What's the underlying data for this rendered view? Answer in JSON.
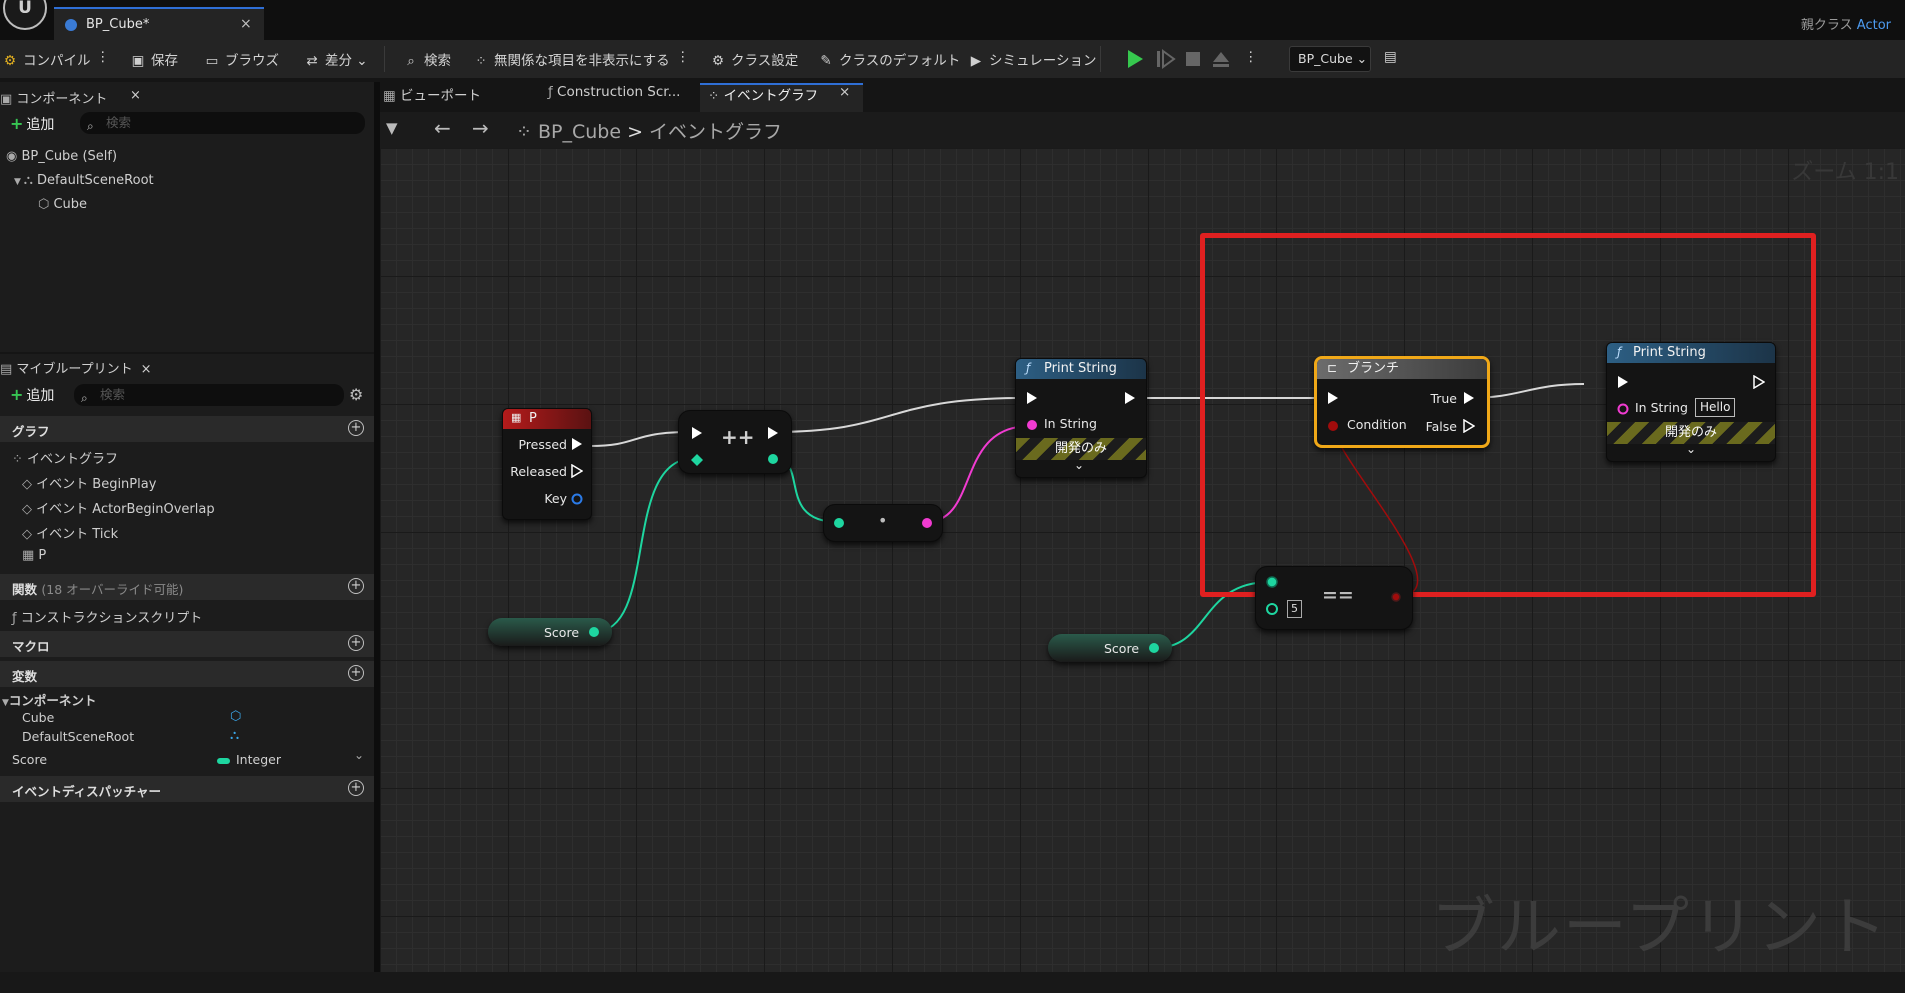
{
  "window": {
    "tab_title": "BP_Cube*",
    "tab_close": "×",
    "parent_class_label": "親クラス",
    "parent_class_value": "Actor"
  },
  "toolbar": {
    "compile": "コンパイル",
    "save": "保存",
    "browse": "ブラウズ",
    "diff": "差分",
    "search": "検索",
    "hide_unrelated": "無関係な項目を非表示にする",
    "class_settings": "クラス設定",
    "class_defaults": "クラスのデフォルト",
    "simulation": "シミュレーション",
    "debug_object": "BP_Cube"
  },
  "components_panel": {
    "tab": "コンポーネント",
    "close": "×",
    "add": "追加",
    "search_placeholder": "検索",
    "items": [
      "BP_Cube (Self)",
      "DefaultSceneRoot",
      "Cube"
    ]
  },
  "my_blueprint": {
    "tab": "マイブループリント",
    "close": "×",
    "add": "追加",
    "search_placeholder": "検索",
    "graphs_header": "グラフ",
    "graphs": [
      "イベントグラフ",
      "イベント BeginPlay",
      "イベント ActorBeginOverlap",
      "イベント Tick",
      "P"
    ],
    "functions_header": "関数",
    "functions_note": "(18 オーバーライド可能)",
    "construction_script": "コンストラクションスクリプト",
    "macros_header": "マクロ",
    "variables_header": "変数",
    "components_group": "コンポーネント",
    "variables": [
      {
        "name": "Cube",
        "type": ""
      },
      {
        "name": "DefaultSceneRoot",
        "type": ""
      },
      {
        "name": "Score",
        "type": "Integer"
      }
    ],
    "dispatchers_header": "イベントディスパッチャー"
  },
  "graph_tabs": {
    "viewport": "ビューポート",
    "construction": "Construction Scr...",
    "event_graph": "イベントグラフ",
    "close": "×"
  },
  "breadcrumb": {
    "blueprint": "BP_Cube",
    "separator": ">",
    "graph": "イベントグラフ"
  },
  "zoom_label": "ズーム 1:1",
  "watermark": "ブループリント",
  "nodes": {
    "key_event": {
      "title": "P",
      "pins": [
        "Pressed",
        "Released",
        "Key"
      ]
    },
    "increment": {
      "symbol": "++"
    },
    "to_string": {
      "symbol": "•"
    },
    "print_string_1": {
      "title": "Print String",
      "pin": "In String",
      "dev_only": "開発のみ"
    },
    "branch": {
      "title": "ブランチ",
      "condition": "Condition",
      "true_pin": "True",
      "false_pin": "False"
    },
    "print_string_2": {
      "title": "Print String",
      "pin": "In String",
      "value": "Hello",
      "dev_only": "開発のみ"
    },
    "equals": {
      "symbol": "==",
      "value": "5"
    },
    "score_get_1": {
      "label": "Score"
    },
    "score_get_2": {
      "label": "Score"
    }
  },
  "colors": {
    "exec": "#ffffff",
    "integer": "#1ed6a0",
    "string": "#f13bd1",
    "bool": "#a10c0c",
    "highlight": "#e02020",
    "event_header": "#a01818",
    "function_header": "#2c5a7a",
    "selection": "#f0a818"
  }
}
